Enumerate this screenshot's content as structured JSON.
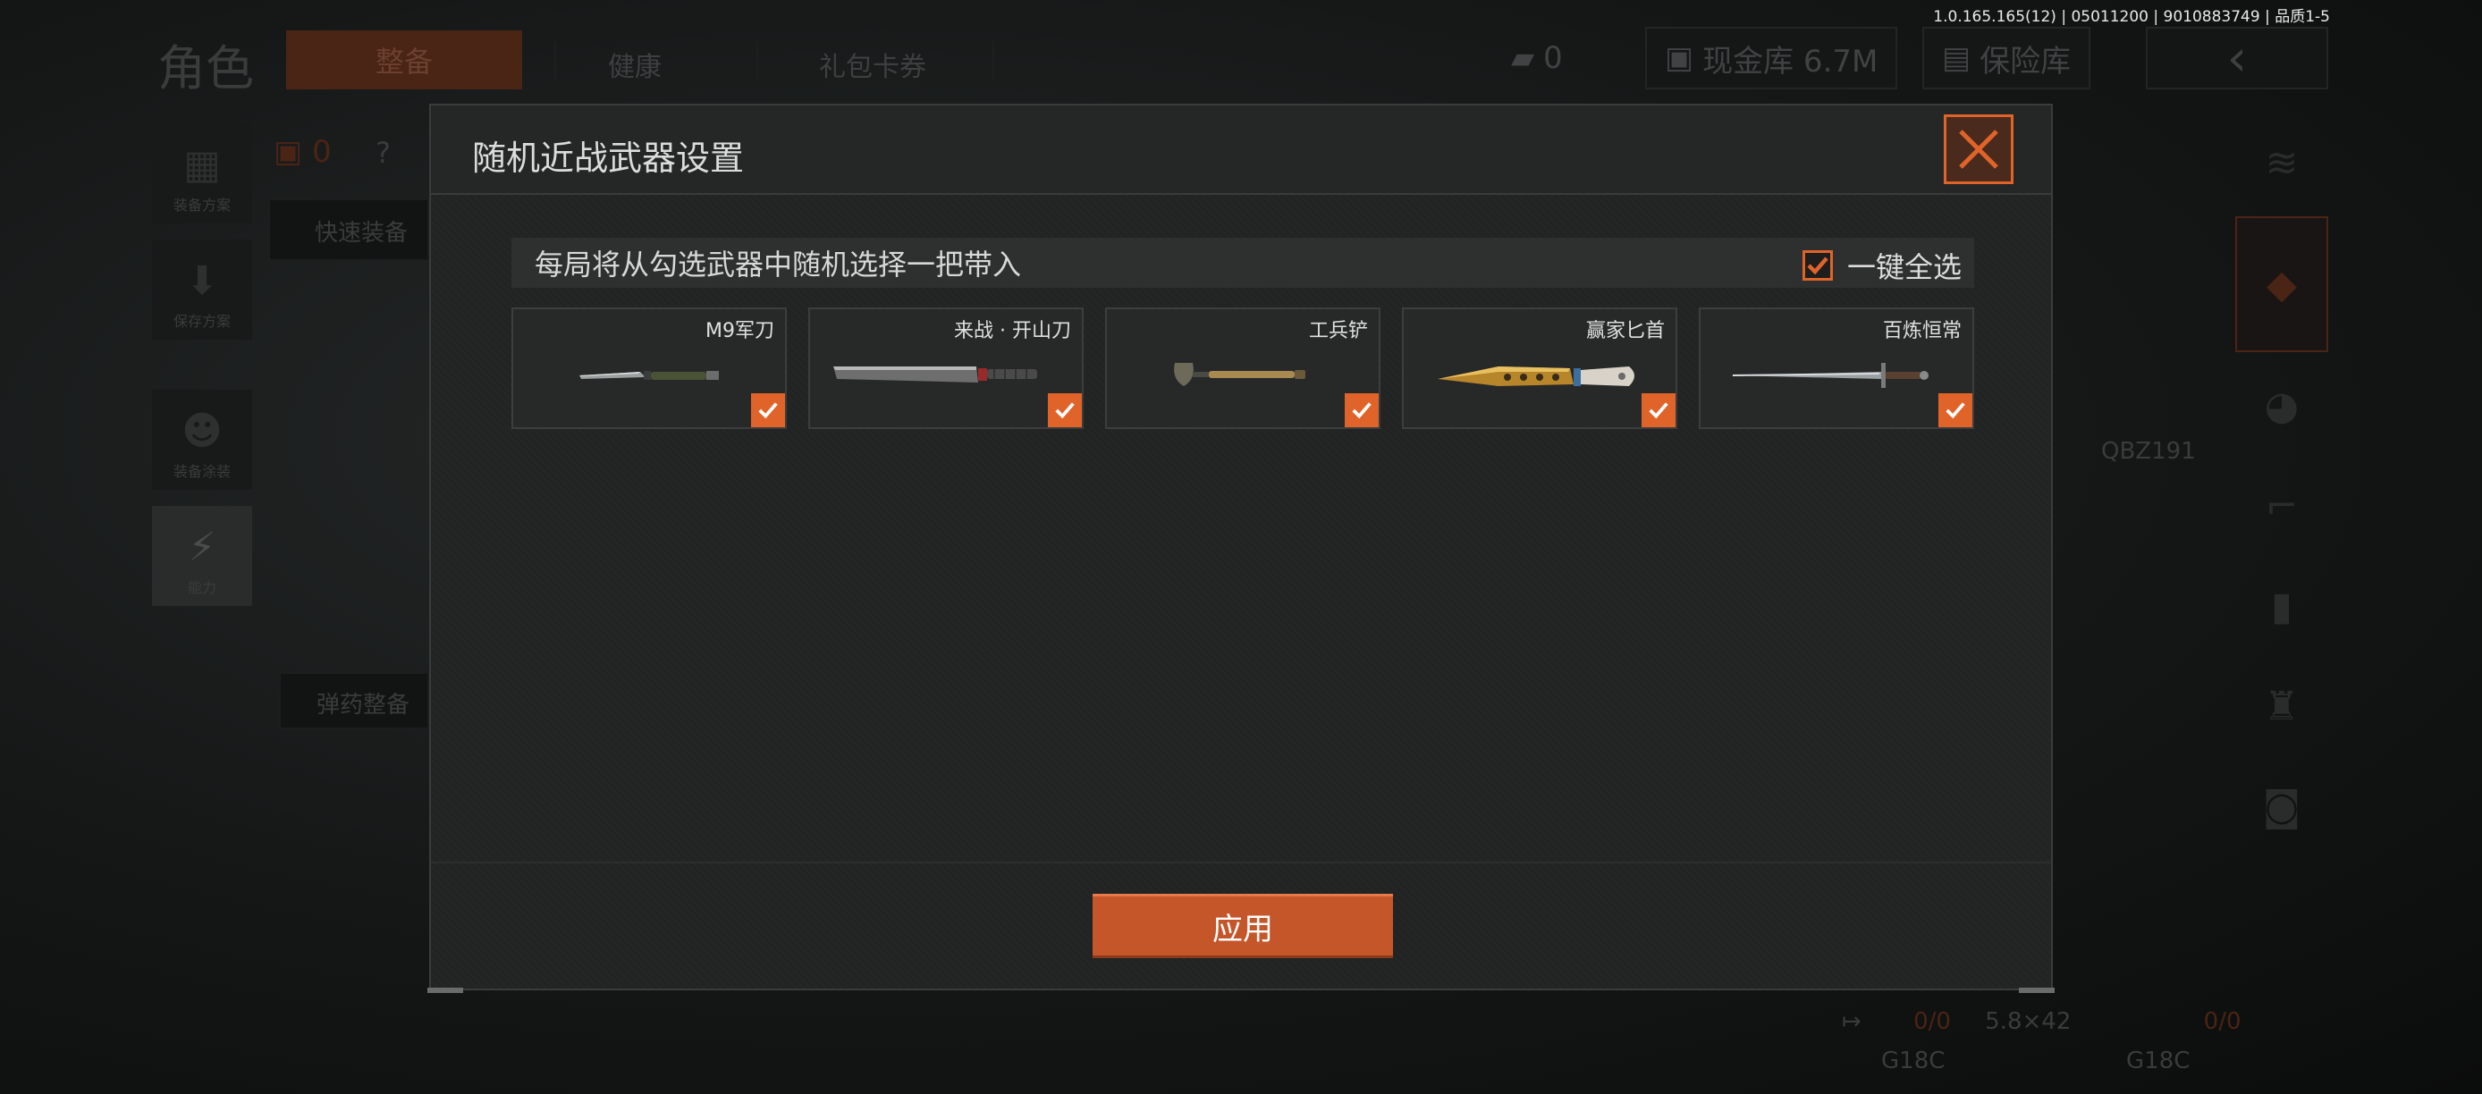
{
  "version_text": "1.0.165.165(12) | 05011200 | 9010883749 | 品质1-5",
  "background": {
    "page_title": "角色",
    "tabs": [
      "整备",
      "健康",
      "礼包卡券"
    ],
    "currency": {
      "coin_value": "0",
      "cash_label": "现金库 6.7M",
      "vault_label": "保险库"
    },
    "left_nav": [
      "装备方案",
      "保存方案",
      "装备涂装",
      "能力"
    ],
    "left_count": "0",
    "help_mark": "?",
    "quick_equip_label": "快速装备",
    "ammo_label": "弹药整备",
    "weapon_name": "QBZ191",
    "ammo": {
      "type": "5.8×42",
      "count_left": "0/0",
      "count_right": "0/0",
      "mag_left": "G18C",
      "mag_right": "G18C"
    }
  },
  "modal": {
    "title": "随机近战武器设置",
    "info_text": "每局将从勾选武器中随机选择一把带入",
    "select_all_label": "一键全选",
    "select_all_checked": true,
    "weapons": [
      {
        "name": "M9军刀",
        "checked": true
      },
      {
        "name": "来战 · 开山刀",
        "checked": true
      },
      {
        "name": "工兵铲",
        "checked": true
      },
      {
        "name": "赢家匕首",
        "checked": true
      },
      {
        "name": "百炼恒常",
        "checked": true
      }
    ],
    "apply_label": "应用"
  },
  "colors": {
    "accent": "#e0642a",
    "modal_bg": "#222323",
    "apply_bg": "#c4562a"
  }
}
